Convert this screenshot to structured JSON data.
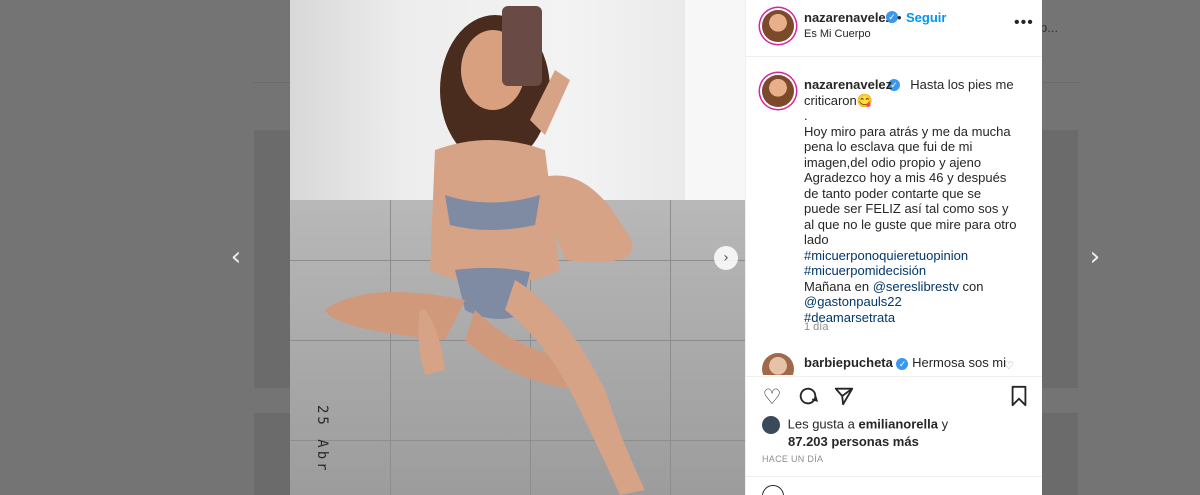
{
  "background": {
    "right_snippet": "p..."
  },
  "post": {
    "username": "nazarenavelez",
    "follow_label": "Seguir",
    "dot": "•",
    "location": "Es Mi Cuerpo",
    "photo_date_stamp": "25 Abr",
    "caption": {
      "text_first": "Hasta los pies me criticaron😋",
      "separator": ".",
      "body": "Hoy miro para atrás y me da mucha pena lo esclava que fui de mi imagen,del odio propio y ajeno Agradezco hoy a mis 46 y después de tanto poder contarte que se puede ser FELIZ así tal como sos y al que no le guste que mire para otro lado",
      "hashtag1": "#micuerponoquieretuopinion",
      "hashtag2": "#micuerpomidecisión",
      "line_manana": "Mañana en",
      "mention1": "@sereslibrestv",
      "con": "con",
      "mention2": "@gastonpauls22",
      "hashtag3": "#deamarsetrata",
      "time": "1 día"
    },
    "comment": {
      "username": "barbiepucheta",
      "text": "Hermosa sos mi"
    },
    "likes": {
      "prefix": "Les gusta a",
      "user": "emilianorella",
      "and": "y",
      "count": "87.203 personas más"
    },
    "timestamp": "HACE UN DÍA"
  },
  "icons": {
    "prev": "chevron-left-icon",
    "next": "chevron-right-icon",
    "like": "heart-icon",
    "comment": "comment-icon",
    "share": "paper-plane-icon",
    "save": "bookmark-icon"
  },
  "colors": {
    "link": "#0095f6",
    "hashtag": "#00376b",
    "verified": "#3897f0"
  }
}
